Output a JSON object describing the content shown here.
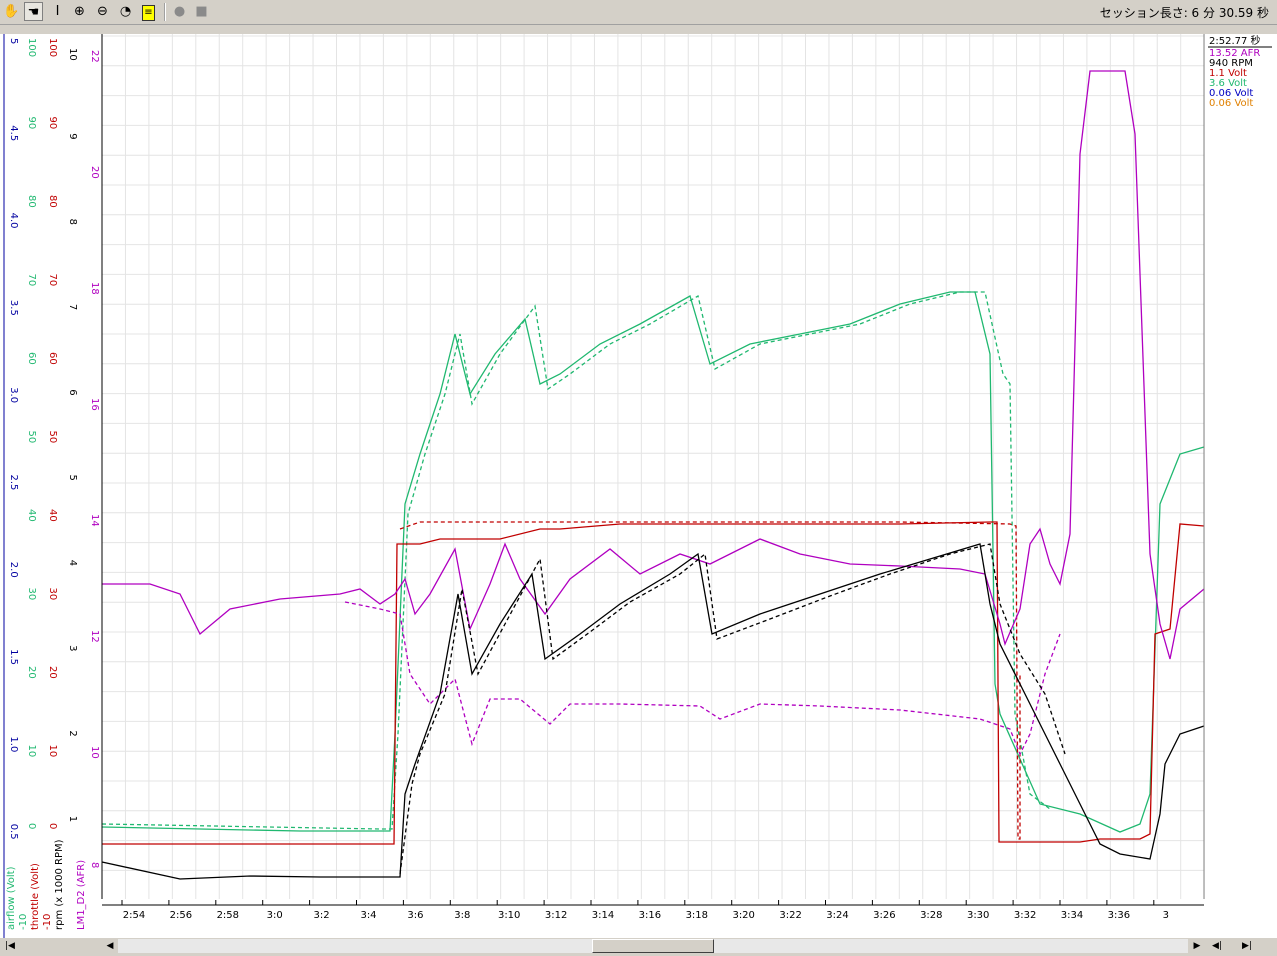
{
  "toolbar": {
    "tools": [
      "hand-tool",
      "drag-tool",
      "cursor-tool",
      "zoom-in",
      "zoom-out",
      "reset-zoom",
      "note",
      "record",
      "stop"
    ],
    "session_label": "セッション長さ: 6 分 30.59 秒"
  },
  "colors": {
    "airflow": "#20b870",
    "throttle": "#c00000",
    "rpm": "#000000",
    "lm1": "#b000c0",
    "aux1": "#000090",
    "aux2": "#e08000",
    "axis_blue": "#0000a0"
  },
  "readout": {
    "time": "2:52.77 秒",
    "values": [
      {
        "text": "13.52 AFR",
        "color": "#b000c0"
      },
      {
        "text": "940 RPM",
        "color": "#000000"
      },
      {
        "text": "1.1 Volt",
        "color": "#c00000"
      },
      {
        "text": "3.6 Volt",
        "color": "#20b870"
      },
      {
        "text": "0.06 Volt",
        "color": "#0000c0"
      },
      {
        "text": "0.06 Volt",
        "color": "#e08000"
      }
    ]
  },
  "axes": {
    "blue_ticks": [
      "5",
      "4.5",
      "4.0",
      "3.5",
      "3.0",
      "2.5",
      "2.0",
      "1.5",
      "1.0",
      "0.5"
    ],
    "green_ticks": [
      "100",
      "90",
      "80",
      "70",
      "60",
      "50",
      "40",
      "30",
      "20",
      "10",
      "0"
    ],
    "red_ticks": [
      "100",
      "90",
      "80",
      "70",
      "60",
      "50",
      "40",
      "30",
      "20",
      "10",
      "0"
    ],
    "black_ticks": [
      "10",
      "9",
      "8",
      "7",
      "6",
      "5",
      "4",
      "3",
      "2",
      "1"
    ],
    "magenta_ticks": [
      "22",
      "20",
      "18",
      "16",
      "14",
      "12",
      "10",
      "8"
    ],
    "labels": [
      {
        "text": "airflow (Volt)",
        "color": "#20b870"
      },
      {
        "text": "-10",
        "color": "#20b870"
      },
      {
        "text": "throttle (Volt)",
        "color": "#c00000"
      },
      {
        "text": "-10",
        "color": "#c00000"
      },
      {
        "text": "rpm (x 1000 RPM)",
        "color": "#000000"
      },
      {
        "text": "LM1_D2 (AFR)",
        "color": "#b000c0"
      }
    ],
    "x_ticks": [
      "2:54",
      "2:56",
      "2:58",
      "3:0",
      "3:2",
      "3:4",
      "3:6",
      "3:8",
      "3:10",
      "3:12",
      "3:14",
      "3:16",
      "3:18",
      "3:20",
      "3:22",
      "3:24",
      "3:26",
      "3:28",
      "3:30",
      "3:32",
      "3:34",
      "3:36",
      "3"
    ]
  },
  "traces": {
    "green_solid": [
      [
        102,
        793
      ],
      [
        200,
        795
      ],
      [
        300,
        797
      ],
      [
        390,
        797
      ],
      [
        395,
        700
      ],
      [
        405,
        470
      ],
      [
        420,
        420
      ],
      [
        440,
        360
      ],
      [
        455,
        300
      ],
      [
        470,
        360
      ],
      [
        495,
        320
      ],
      [
        525,
        285
      ],
      [
        540,
        350
      ],
      [
        560,
        340
      ],
      [
        600,
        310
      ],
      [
        640,
        290
      ],
      [
        690,
        262
      ],
      [
        710,
        330
      ],
      [
        750,
        310
      ],
      [
        800,
        300
      ],
      [
        850,
        290
      ],
      [
        900,
        270
      ],
      [
        950,
        258
      ],
      [
        975,
        258
      ],
      [
        990,
        320
      ],
      [
        995,
        650
      ],
      [
        1000,
        680
      ],
      [
        1040,
        770
      ],
      [
        1080,
        780
      ],
      [
        1120,
        798
      ],
      [
        1140,
        790
      ],
      [
        1150,
        760
      ],
      [
        1160,
        470
      ],
      [
        1180,
        420
      ],
      [
        1204,
        413
      ]
    ],
    "green_dashed": [
      [
        102,
        790
      ],
      [
        380,
        795
      ],
      [
        392,
        795
      ],
      [
        398,
        700
      ],
      [
        408,
        480
      ],
      [
        425,
        420
      ],
      [
        445,
        360
      ],
      [
        460,
        300
      ],
      [
        472,
        370
      ],
      [
        500,
        320
      ],
      [
        535,
        272
      ],
      [
        548,
        355
      ],
      [
        570,
        340
      ],
      [
        610,
        310
      ],
      [
        650,
        290
      ],
      [
        698,
        262
      ],
      [
        715,
        335
      ],
      [
        760,
        310
      ],
      [
        810,
        300
      ],
      [
        860,
        290
      ],
      [
        910,
        270
      ],
      [
        960,
        258
      ],
      [
        985,
        258
      ],
      [
        1003,
        340
      ],
      [
        1010,
        350
      ],
      [
        1015,
        680
      ],
      [
        1030,
        760
      ],
      [
        1050,
        775
      ]
    ],
    "red_solid": [
      [
        102,
        810
      ],
      [
        390,
        810
      ],
      [
        394,
        810
      ],
      [
        397,
        510
      ],
      [
        420,
        510
      ],
      [
        440,
        505
      ],
      [
        500,
        505
      ],
      [
        540,
        495
      ],
      [
        560,
        495
      ],
      [
        620,
        490
      ],
      [
        700,
        490
      ],
      [
        800,
        490
      ],
      [
        900,
        490
      ],
      [
        990,
        488
      ],
      [
        997,
        488
      ],
      [
        999,
        808
      ],
      [
        1080,
        808
      ],
      [
        1100,
        805
      ],
      [
        1140,
        805
      ],
      [
        1150,
        800
      ],
      [
        1155,
        600
      ],
      [
        1170,
        595
      ],
      [
        1180,
        490
      ],
      [
        1204,
        492
      ]
    ],
    "red_dashed": [
      [
        400,
        495
      ],
      [
        420,
        488
      ],
      [
        500,
        488
      ],
      [
        560,
        488
      ],
      [
        700,
        488
      ],
      [
        900,
        488
      ],
      [
        1010,
        490
      ],
      [
        1016,
        492
      ],
      [
        1018,
        805
      ],
      [
        1020,
        805
      ],
      [
        1020,
        640
      ]
    ],
    "black_solid": [
      [
        102,
        828
      ],
      [
        180,
        845
      ],
      [
        250,
        842
      ],
      [
        320,
        843
      ],
      [
        400,
        843
      ],
      [
        405,
        760
      ],
      [
        415,
        730
      ],
      [
        440,
        660
      ],
      [
        458,
        560
      ],
      [
        472,
        640
      ],
      [
        500,
        590
      ],
      [
        532,
        540
      ],
      [
        545,
        625
      ],
      [
        580,
        600
      ],
      [
        620,
        570
      ],
      [
        670,
        540
      ],
      [
        698,
        520
      ],
      [
        712,
        600
      ],
      [
        760,
        580
      ],
      [
        820,
        560
      ],
      [
        880,
        540
      ],
      [
        940,
        522
      ],
      [
        980,
        510
      ],
      [
        990,
        570
      ],
      [
        1000,
        610
      ],
      [
        1020,
        650
      ],
      [
        1040,
        690
      ],
      [
        1060,
        730
      ],
      [
        1080,
        770
      ],
      [
        1100,
        810
      ],
      [
        1120,
        820
      ],
      [
        1150,
        825
      ],
      [
        1160,
        780
      ],
      [
        1165,
        730
      ],
      [
        1180,
        700
      ],
      [
        1204,
        692
      ]
    ],
    "black_dashed": [
      [
        400,
        840
      ],
      [
        412,
        750
      ],
      [
        420,
        720
      ],
      [
        445,
        660
      ],
      [
        462,
        555
      ],
      [
        478,
        640
      ],
      [
        505,
        590
      ],
      [
        540,
        525
      ],
      [
        553,
        625
      ],
      [
        590,
        598
      ],
      [
        630,
        568
      ],
      [
        680,
        540
      ],
      [
        705,
        520
      ],
      [
        717,
        605
      ],
      [
        770,
        585
      ],
      [
        830,
        562
      ],
      [
        890,
        540
      ],
      [
        950,
        520
      ],
      [
        990,
        510
      ],
      [
        1000,
        570
      ],
      [
        1020,
        620
      ],
      [
        1045,
        660
      ],
      [
        1065,
        720
      ]
    ],
    "magenta_solid": [
      [
        102,
        550
      ],
      [
        150,
        550
      ],
      [
        180,
        560
      ],
      [
        200,
        600
      ],
      [
        230,
        575
      ],
      [
        280,
        565
      ],
      [
        340,
        560
      ],
      [
        360,
        555
      ],
      [
        380,
        570
      ],
      [
        395,
        560
      ],
      [
        405,
        545
      ],
      [
        415,
        580
      ],
      [
        430,
        560
      ],
      [
        455,
        515
      ],
      [
        470,
        595
      ],
      [
        490,
        550
      ],
      [
        505,
        510
      ],
      [
        520,
        545
      ],
      [
        545,
        580
      ],
      [
        570,
        545
      ],
      [
        610,
        515
      ],
      [
        640,
        540
      ],
      [
        680,
        520
      ],
      [
        710,
        530
      ],
      [
        760,
        505
      ],
      [
        800,
        520
      ],
      [
        850,
        530
      ],
      [
        900,
        532
      ],
      [
        960,
        535
      ],
      [
        985,
        540
      ],
      [
        1000,
        590
      ],
      [
        1005,
        610
      ],
      [
        1020,
        575
      ],
      [
        1030,
        510
      ],
      [
        1040,
        495
      ],
      [
        1050,
        530
      ],
      [
        1060,
        550
      ],
      [
        1070,
        500
      ],
      [
        1080,
        120
      ],
      [
        1090,
        37
      ],
      [
        1125,
        37
      ],
      [
        1135,
        100
      ],
      [
        1150,
        520
      ],
      [
        1160,
        590
      ],
      [
        1170,
        625
      ],
      [
        1180,
        575
      ],
      [
        1204,
        555
      ]
    ],
    "magenta_dashed": [
      [
        345,
        568
      ],
      [
        380,
        575
      ],
      [
        400,
        580
      ],
      [
        410,
        640
      ],
      [
        430,
        670
      ],
      [
        455,
        645
      ],
      [
        472,
        710
      ],
      [
        490,
        665
      ],
      [
        520,
        665
      ],
      [
        550,
        690
      ],
      [
        570,
        670
      ],
      [
        620,
        670
      ],
      [
        700,
        672
      ],
      [
        720,
        685
      ],
      [
        760,
        670
      ],
      [
        820,
        672
      ],
      [
        900,
        676
      ],
      [
        980,
        685
      ],
      [
        995,
        690
      ],
      [
        1010,
        695
      ],
      [
        1020,
        720
      ],
      [
        1030,
        700
      ],
      [
        1045,
        640
      ],
      [
        1060,
        600
      ]
    ],
    "aux_orange": [
      [
        102,
        897
      ],
      [
        1204,
        897
      ]
    ],
    "aux_blue": [
      [
        400,
        896
      ],
      [
        1015,
        896
      ]
    ]
  }
}
